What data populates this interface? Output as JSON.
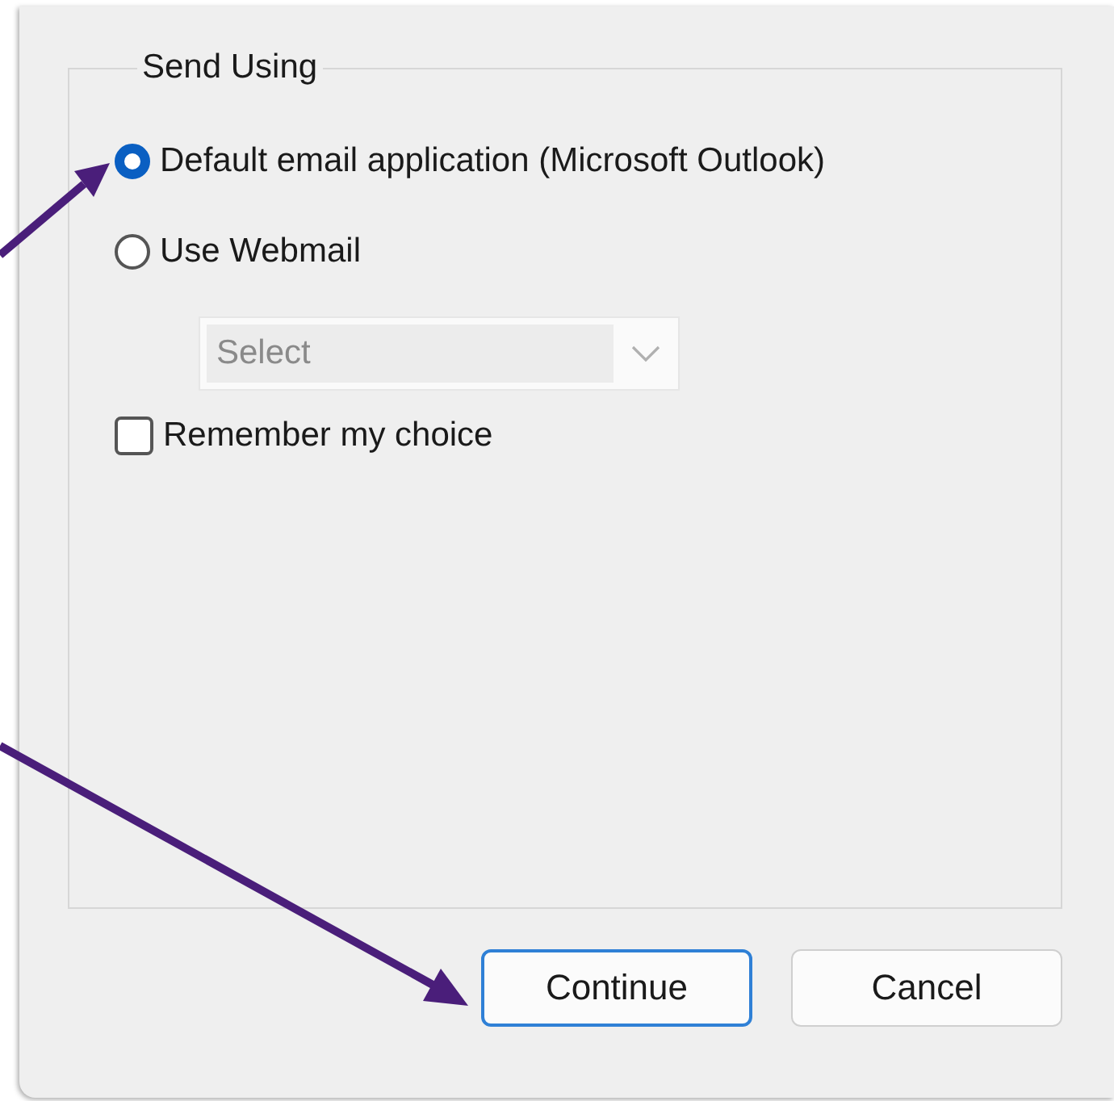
{
  "group": {
    "legend": "Send Using"
  },
  "options": [
    {
      "label": "Default email application (Microsoft Outlook)",
      "selected": true
    },
    {
      "label": "Use Webmail",
      "selected": false
    }
  ],
  "webmail_select": {
    "placeholder": "Select",
    "disabled": true
  },
  "remember": {
    "label": "Remember my choice",
    "checked": false
  },
  "buttons": [
    {
      "label": "Continue",
      "default": true
    },
    {
      "label": "Cancel",
      "default": false
    }
  ]
}
